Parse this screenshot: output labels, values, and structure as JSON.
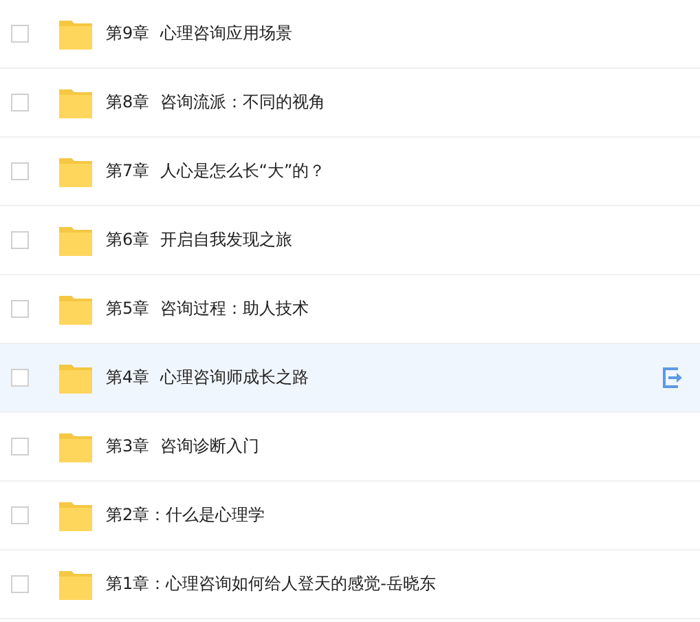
{
  "files": [
    {
      "name": "第9章  心理咨询应用场景",
      "checked": false,
      "hovered": false
    },
    {
      "name": "第8章  咨询流派：不同的视角",
      "checked": false,
      "hovered": false
    },
    {
      "name": "第7章  人心是怎么长“大”的？",
      "checked": false,
      "hovered": false
    },
    {
      "name": "第6章  开启自我发现之旅",
      "checked": false,
      "hovered": false
    },
    {
      "name": "第5章  咨询过程：助人技术",
      "checked": false,
      "hovered": false
    },
    {
      "name": "第4章  心理咨询师成长之路",
      "checked": false,
      "hovered": true
    },
    {
      "name": "第3章  咨询诊断入门",
      "checked": false,
      "hovered": false
    },
    {
      "name": "第2章：什么是心理学",
      "checked": false,
      "hovered": false
    },
    {
      "name": "第1章：心理咨询如何给人登天的感觉-岳晓东",
      "checked": false,
      "hovered": false
    }
  ]
}
